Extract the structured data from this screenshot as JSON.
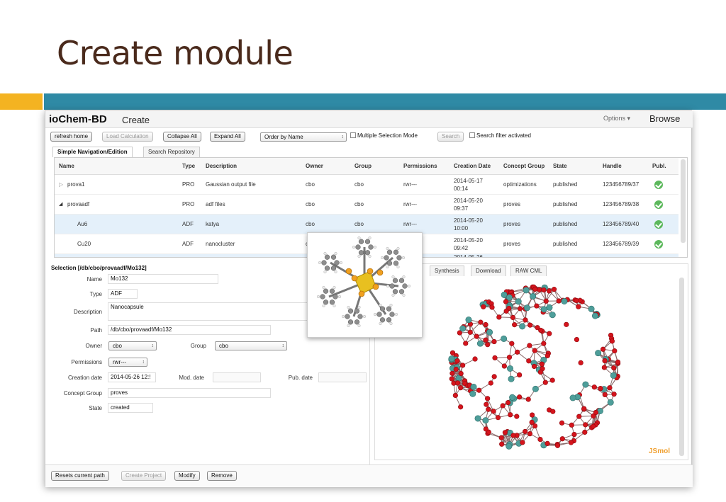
{
  "slide": {
    "title": "Create module"
  },
  "colors": {
    "accent_orange": "#f4b321",
    "accent_teal": "#2f8aa5",
    "title_brown": "#4a2a1c",
    "status_ok": "#5cb85c",
    "jsmol": "#f0a030"
  },
  "header": {
    "brand": "ioChem-BD",
    "nav_create": "Create",
    "options": "Options ▾",
    "browse": "Browse"
  },
  "toolbar": {
    "refresh_home": "refresh home",
    "load_calculation": "Load Calculation",
    "collapse_all": "Collapse All",
    "expand_all": "Expand All",
    "order_by": "Order by Name",
    "multiple_selection": "Multiple Selection Mode",
    "search": "Search",
    "search_filter": "Search filter activated"
  },
  "tabs": {
    "simple_nav": "Simple Navigation/Edition",
    "search_repo": "Search Repository"
  },
  "grid": {
    "columns": [
      "Name",
      "Type",
      "Description",
      "Owner",
      "Group",
      "Permissions",
      "Creation Date",
      "Concept Group",
      "State",
      "Handle",
      "Publ."
    ],
    "rows": [
      {
        "expander": "▷",
        "name": "prova1",
        "type": "PRO",
        "description": "Gaussian output file",
        "owner": "cbo",
        "group": "cbo",
        "permissions": "rwr---",
        "date": "2014-05-17",
        "time": "00:14",
        "concept": "optimizations",
        "state": "published",
        "handle": "123456789/37"
      },
      {
        "expander": "◢",
        "name": "provaadf",
        "type": "PRO",
        "description": "adf files",
        "owner": "cbo",
        "group": "cbo",
        "permissions": "rwr---",
        "date": "2014-05-20",
        "time": "09:37",
        "concept": "proves",
        "state": "published",
        "handle": "123456789/38"
      },
      {
        "expander": "",
        "name": "Au6",
        "type": "ADF",
        "description": "katya",
        "owner": "cbo",
        "group": "cbo",
        "permissions": "rwr---",
        "date": "2014-05-20",
        "time": "10:00",
        "concept": "proves",
        "state": "published",
        "handle": "123456789/40"
      },
      {
        "expander": "",
        "name": "Cu20",
        "type": "ADF",
        "description": "nanocluster",
        "owner": "cl",
        "group": "",
        "permissions": "",
        "date": "2014-05-20",
        "time": "09:42",
        "concept": "proves",
        "state": "published",
        "handle": "123456789/39"
      }
    ],
    "partial_date": "2014-05-26"
  },
  "selection": {
    "title": "Selection [/db/cbo/provaadf/Mo132]",
    "labels": {
      "name": "Name",
      "type": "Type",
      "description": "Description",
      "path": "Path",
      "owner": "Owner",
      "group": "Group",
      "permissions": "Permissions",
      "creation_date": "Creation date",
      "mod_date": "Mod. date",
      "pub_date": "Pub. date",
      "concept_group": "Concept Group",
      "state": "State"
    },
    "values": {
      "name": "Mo132",
      "type": "ADF",
      "description": "Nanocapsule",
      "path": "/db/cbo/provaadf/Mo132",
      "owner": "cbo",
      "group": "cbo",
      "permissions": "rwr---",
      "creation_date": "2014-05-26 12:!",
      "concept_group": "proves",
      "state": "created"
    }
  },
  "viewer_tabs": {
    "synthesis": "Synthesis",
    "download": "Download",
    "raw_cml": "RAW CML"
  },
  "viewer": {
    "logo": "JSmol"
  },
  "bottom": {
    "reset_path": "Resets current path",
    "create_project": "Create Project",
    "modify": "Modify",
    "remove": "Remove"
  }
}
